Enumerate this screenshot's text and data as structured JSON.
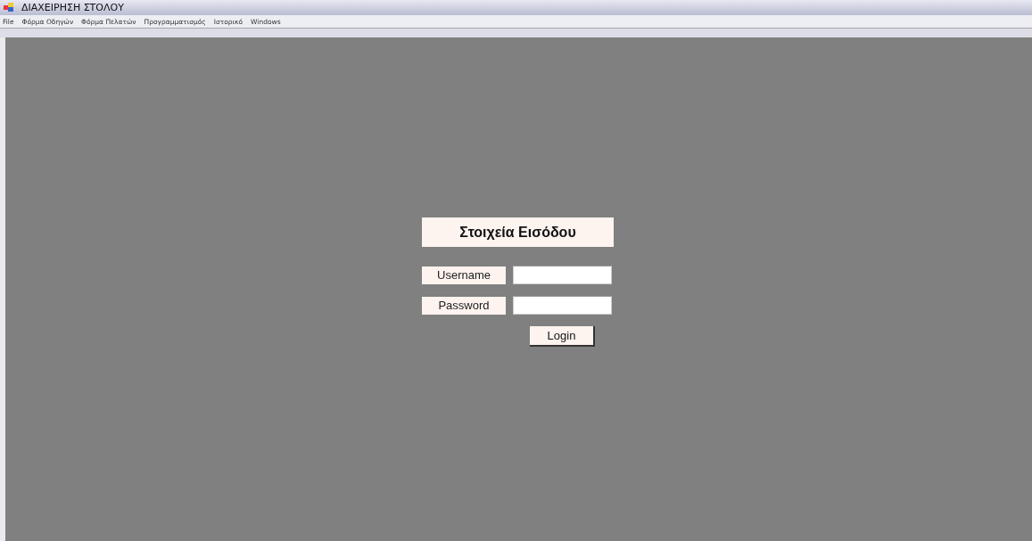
{
  "window": {
    "title": "ΔΙΑΧΕΙΡΗΣΗ ΣΤΟΛΟΥ"
  },
  "menu": [
    "File",
    "Φόρμα Οδηγών",
    "Φόρμα Πελατών",
    "Προγραμματισμός",
    "Ιστορικό",
    "Windows"
  ],
  "login": {
    "title": "Στοιχεία Εισόδου",
    "fields": [
      {
        "label": "Username"
      },
      {
        "label": "Password"
      }
    ],
    "button": "Login"
  }
}
